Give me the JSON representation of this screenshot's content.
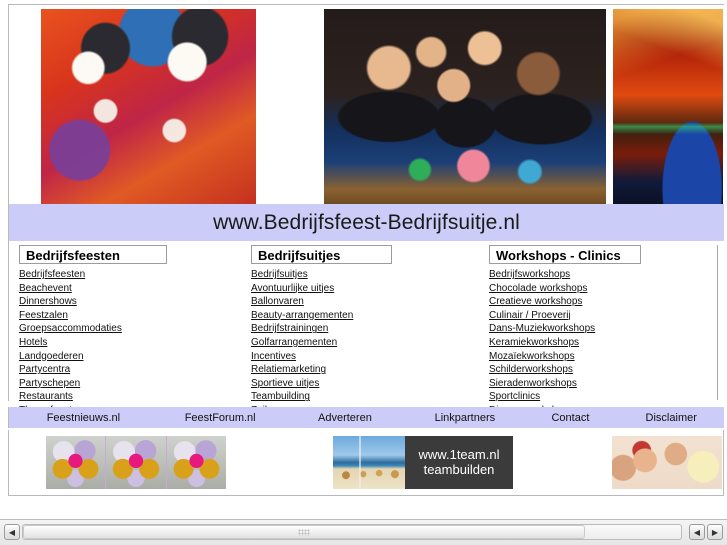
{
  "site": {
    "title": "www.Bedrijfsfeest-Bedrijfsuitje.nl"
  },
  "colors": {
    "band_background": "#ccccf8",
    "page_background": "#ffffff",
    "link_text": "#111111",
    "ad_plate_background": "#3b3b3b"
  },
  "hero": {
    "images": [
      {
        "name": "carnival-clowns-photo",
        "alt": "Twee gemaskerde carnavalsclowns in oranje kostuums"
      },
      {
        "name": "casino-roulette-photo",
        "alt": "Lachende mensen in smoking aan een roulettetafel"
      },
      {
        "name": "concert-stage-photo",
        "alt": "Podium met rode showverlichting boven publiek"
      }
    ]
  },
  "columns": [
    {
      "heading": "Bedrijfsfeesten",
      "links": [
        "Bedrijfsfeesten",
        "Beachevent",
        "Dinnershows",
        "Feestzalen",
        "Groepsaccommodaties",
        "Hotels",
        "Landgoederen",
        "Partycentra",
        "Partyschepen",
        "Restaurants",
        "Themafeesten"
      ]
    },
    {
      "heading": "Bedrijfsuitjes",
      "links": [
        "Bedrijfsuitjes",
        "Avontuurlijke uitjes",
        "Ballonvaren",
        "Beauty-arrangementen",
        "Bedrijfstrainingen",
        "Golfarrangementen",
        "Incentives",
        "Relatiemarketing",
        "Sportieve uitjes",
        "Teambuilding",
        "Zeilen"
      ]
    },
    {
      "heading": "Workshops - Clinics",
      "links": [
        "Bedrijfsworkshops",
        "Chocolade workshops",
        "Creatieve workshops",
        "Culinair / Proeverij",
        "Dans-Muziekworkshops",
        "Keramiekworkshops",
        "Mozaïekworkshops",
        "Schilderworkshops",
        "Sieradenworkshops",
        "Sportclinics",
        "Diverse workshops"
      ]
    }
  ],
  "nav": {
    "items": [
      "Feestnieuws.nl",
      "FeestForum.nl",
      "Adverteren",
      "Linkpartners",
      "Contact",
      "Disclaimer"
    ]
  },
  "banners": {
    "balloons": {
      "name": "balloon-decoration-banner",
      "alt": "Ballonnen decoratie"
    },
    "oneteam": {
      "line1": "www.1team.nl",
      "line2": "teambuilden",
      "alt": "Beachvolleybal op het strand"
    },
    "party": {
      "name": "party-people-banner",
      "alt": "Feestende mensen met drankjes"
    }
  },
  "scrollbar": {
    "left_arrow": "◀",
    "right_prev": "◀",
    "right_next": "▶"
  }
}
